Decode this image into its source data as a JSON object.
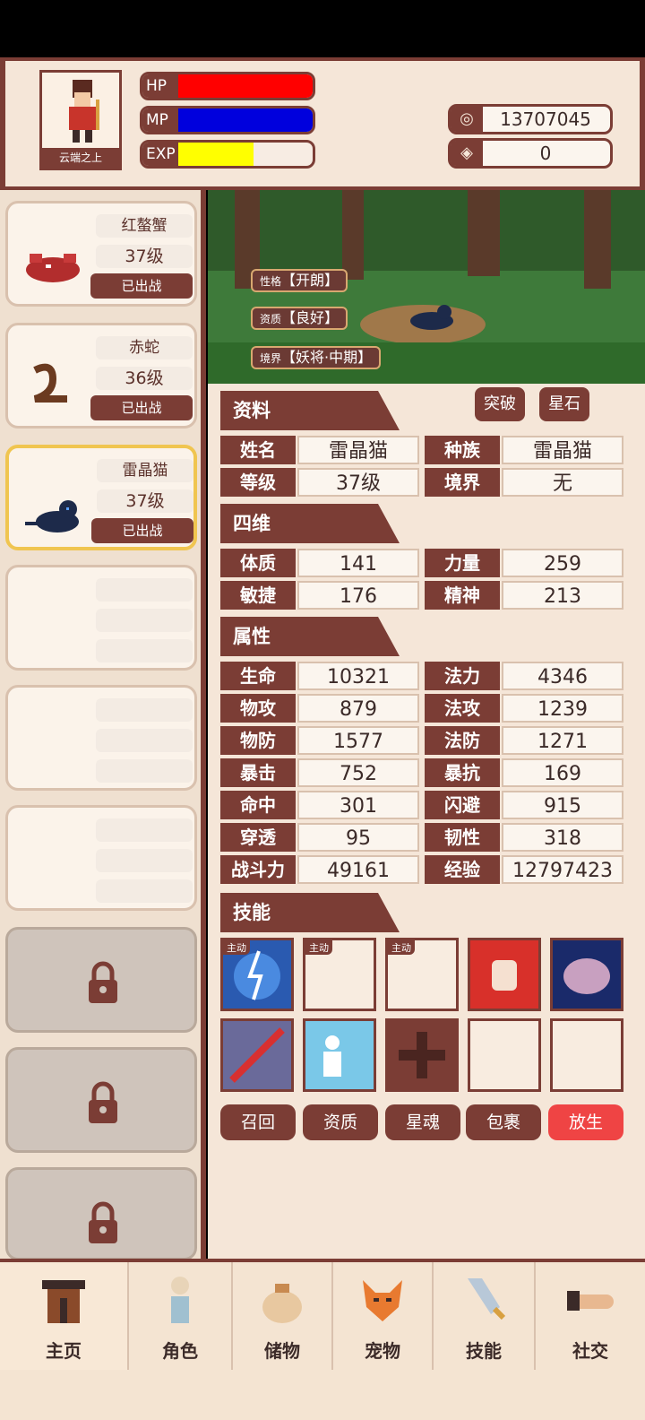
{
  "player": {
    "name": "云端之上"
  },
  "bars": {
    "hp_label": "HP",
    "mp_label": "MP",
    "exp_label": "EXP",
    "hp": 1.0,
    "mp": 1.0,
    "exp": 0.56
  },
  "currency": {
    "gold": "13707045",
    "gems": "0"
  },
  "colors": {
    "hp": "#ff0000",
    "mp": "#0000dd",
    "exp": "#ffff00",
    "accent": "#7b3d35",
    "release": "#ef4444"
  },
  "pets": [
    {
      "name": "红螯蟹",
      "level": "37级",
      "status": "已出战"
    },
    {
      "name": "赤蛇",
      "level": "36级",
      "status": "已出战"
    },
    {
      "name": "雷晶猫",
      "level": "37级",
      "status": "已出战"
    }
  ],
  "scene_tags": {
    "personality_label": "性格",
    "personality": "【开朗】",
    "aptitude_label": "资质",
    "aptitude": "【良好】",
    "realm_label": "境界",
    "realm": "【妖将·中期】"
  },
  "buttons": {
    "breakthrough": "突破",
    "starstone": "星石"
  },
  "sections": {
    "info": "资料",
    "four_dim": "四维",
    "attrs": "属性",
    "skills": "技能"
  },
  "info": [
    {
      "k1": "姓名",
      "v1": "雷晶猫",
      "k2": "种族",
      "v2": "雷晶猫"
    },
    {
      "k1": "等级",
      "v1": "37级",
      "k2": "境界",
      "v2": "无"
    }
  ],
  "four_dim": [
    {
      "k1": "体质",
      "v1": "141",
      "k2": "力量",
      "v2": "259"
    },
    {
      "k1": "敏捷",
      "v1": "176",
      "k2": "精神",
      "v2": "213"
    }
  ],
  "attrs": [
    {
      "k1": "生命",
      "v1": "10321",
      "k2": "法力",
      "v2": "4346"
    },
    {
      "k1": "物攻",
      "v1": "879",
      "k2": "法攻",
      "v2": "1239"
    },
    {
      "k1": "物防",
      "v1": "1577",
      "k2": "法防",
      "v2": "1271"
    },
    {
      "k1": "暴击",
      "v1": "752",
      "k2": "暴抗",
      "v2": "169"
    },
    {
      "k1": "命中",
      "v1": "301",
      "k2": "闪避",
      "v2": "915"
    },
    {
      "k1": "穿透",
      "v1": "95",
      "k2": "韧性",
      "v2": "318"
    },
    {
      "k1": "战斗力",
      "v1": "49161",
      "k2": "经验",
      "v2": "12797423"
    }
  ],
  "skill_tag": "主动",
  "actions": {
    "recall": "召回",
    "aptitude": "资质",
    "starsoul": "星魂",
    "bag": "包裹",
    "release": "放生"
  },
  "nav": [
    {
      "label": "主页"
    },
    {
      "label": "角色"
    },
    {
      "label": "储物"
    },
    {
      "label": "宠物"
    },
    {
      "label": "技能"
    },
    {
      "label": "社交"
    }
  ]
}
